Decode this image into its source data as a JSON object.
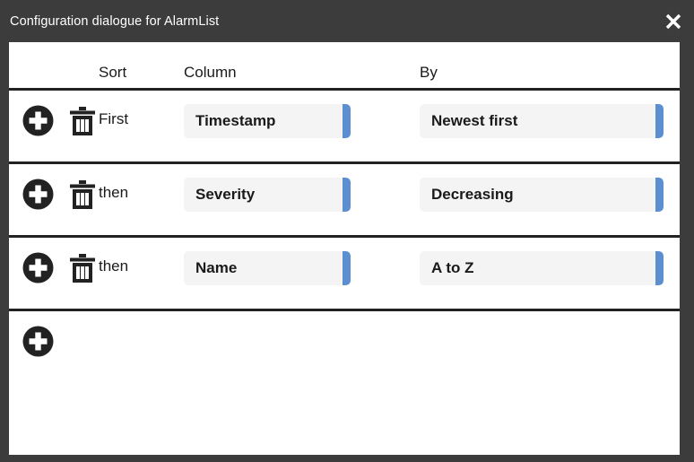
{
  "window": {
    "title": "Configuration dialogue for AlarmList",
    "close_icon": "close-icon"
  },
  "colors": {
    "titlebar_bg": "#3c3c3c",
    "panel_bg": "#ffffff",
    "row_divider": "#222222",
    "dropdown_bg": "#f4f4f4",
    "dropdown_accent": "#5b8fd0",
    "text": "#1a1a1a"
  },
  "table": {
    "headers": {
      "sort": "Sort",
      "column": "Column",
      "by": "By"
    },
    "rows": [
      {
        "add_icon": "plus-circle-icon",
        "delete_icon": "trash-icon",
        "order_label": "First",
        "column_value": "Timestamp",
        "by_value": "Newest first"
      },
      {
        "add_icon": "plus-circle-icon",
        "delete_icon": "trash-icon",
        "order_label": "then",
        "column_value": "Severity",
        "by_value": "Decreasing"
      },
      {
        "add_icon": "plus-circle-icon",
        "delete_icon": "trash-icon",
        "order_label": "then",
        "column_value": "Name",
        "by_value": "A to Z"
      }
    ],
    "add_row": {
      "add_icon": "plus-circle-icon"
    }
  }
}
